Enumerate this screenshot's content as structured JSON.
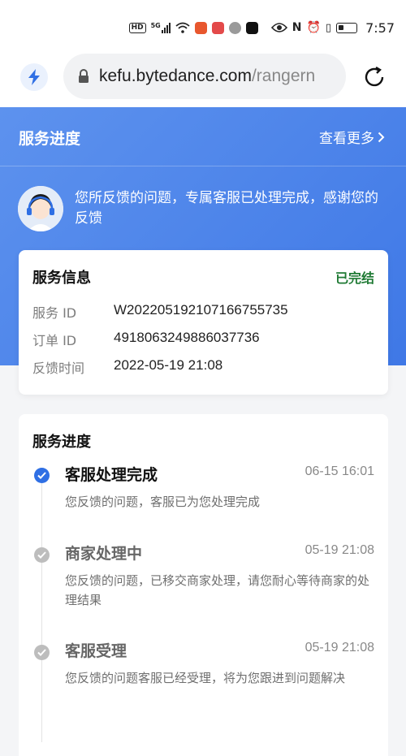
{
  "status_bar": {
    "hd_label": "HD",
    "network_label": "5G",
    "time": "7:57",
    "app_icon_colors": [
      "#e8572e",
      "#e34a4a",
      "#9a9a9a",
      "#111111"
    ]
  },
  "browser": {
    "url_host": "kefu.bytedance.com",
    "url_path": "/rangern"
  },
  "header": {
    "title": "服务进度",
    "view_more": "查看更多",
    "message": "您所反馈的问题，专属客服已处理完成，感谢您的反馈"
  },
  "service_info": {
    "title": "服务信息",
    "status": "已完结",
    "rows": [
      {
        "label": "服务 ID",
        "value": "W20220519210716675573​5"
      },
      {
        "label": "订单 ID",
        "value": "4918063249886037736"
      },
      {
        "label": "反馈时间",
        "value": "2022-05-19 21:08"
      }
    ]
  },
  "progress": {
    "title": "服务进度",
    "steps": [
      {
        "title": "客服处理完成",
        "time": "06-15 16:01",
        "desc": "您反馈的问题，客服已为您处理完成",
        "state": "done"
      },
      {
        "title": "商家处理中",
        "time": "05-19 21:08",
        "desc": "您反馈的问题，已移交商家处理，请您耐心等待商家的处理结果",
        "state": "past"
      },
      {
        "title": "客服受理",
        "time": "05-19 21:08",
        "desc": "您反馈的问题客服已经受理，将为您跟进到问题解决",
        "state": "past"
      }
    ]
  },
  "colors": {
    "accent_blue": "#3f78e6",
    "done_green": "#1f7a34",
    "check_blue": "#2f6fe4",
    "check_grey": "#bdbdbd"
  },
  "icons": [
    "bolt-icon",
    "lock-icon",
    "reload-icon",
    "chevron-right-icon",
    "check-circle-icon",
    "avatar-agent-icon"
  ]
}
